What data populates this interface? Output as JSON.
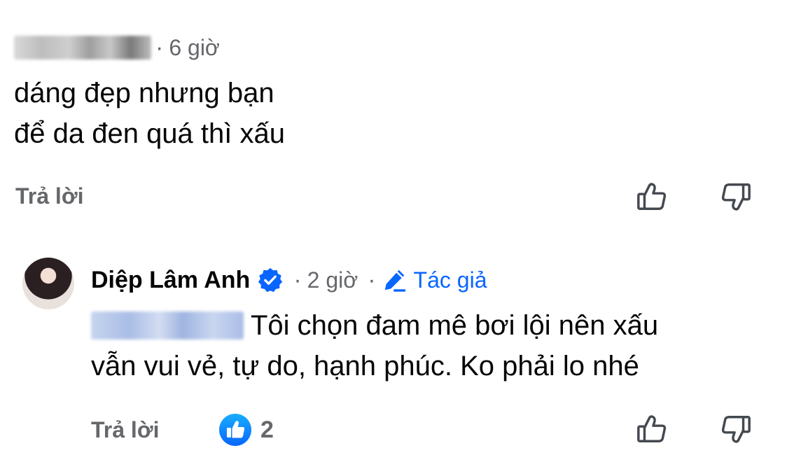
{
  "comment1": {
    "time": "6 giờ",
    "lines": [
      "dáng đẹp nhưng bạn",
      "để da đen quá thì xấu"
    ],
    "reply_label": "Trả lời"
  },
  "comment2": {
    "author": "Diệp Lâm Anh",
    "time": "2 giờ",
    "author_badge": "Tác giả",
    "text_line1": "Tôi chọn đam mê bơi lội nên xấu",
    "text_line2": "vẫn vui vẻ, tự do, hạnh phúc. Ko phải lo nhé",
    "reply_label": "Trả lời",
    "reaction_count": "2"
  },
  "separator": "·",
  "icons": {
    "upvote": "thumbs-up-outline-icon",
    "downvote": "thumbs-down-outline-icon",
    "verified": "verified-badge-icon",
    "author": "pencil-icon",
    "reaction": "like-reaction-icon"
  },
  "colors": {
    "accent": "#0866ff",
    "secondary_text": "#65676b",
    "primary_text": "#050505"
  }
}
